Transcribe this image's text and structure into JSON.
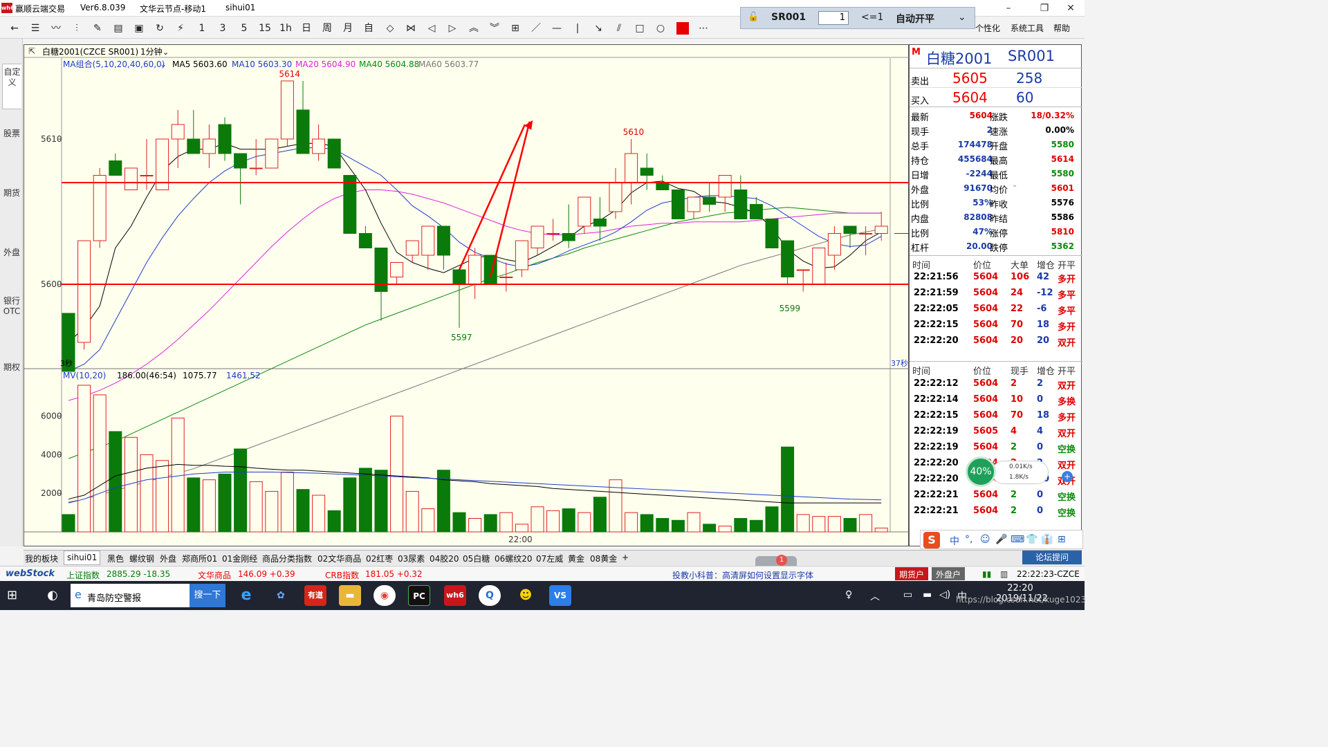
{
  "window": {
    "app_name": "赢顺云端交易",
    "version": "Ver6.8.039",
    "server": "文华云节点-移动1",
    "user": "sihui01",
    "logo_text": "wh6"
  },
  "trade_widget": {
    "contract": "SR001",
    "quantity": "1",
    "limit": "<=1",
    "mode": "自动开平"
  },
  "toolbar": {
    "buttons": [
      "back-icon",
      "table-icon",
      "line-chart-icon",
      "bar-icon",
      "pen-icon",
      "report-icon",
      "save-icon",
      "refresh-icon",
      "zigzag-icon"
    ],
    "periods": [
      "1",
      "3",
      "5",
      "15",
      "1h",
      "日",
      "周",
      "月",
      "自"
    ],
    "draw_tools": [
      "fit-icon",
      "collapse-icon",
      "left-icon",
      "right-icon",
      "up-icon",
      "down-icon",
      "grid-icon",
      "line-icon",
      "hline-icon",
      "vline-icon",
      "ray-icon",
      "parallel-icon",
      "rect-icon",
      "ellipse-icon",
      "color-icon",
      "more-icon"
    ],
    "menus": [
      "个性化",
      "系统工具",
      "帮助"
    ]
  },
  "left_tabs": [
    "自定义",
    "股票",
    "期货",
    "外盘",
    "银行OTC",
    "期权"
  ],
  "chart": {
    "header_title": "白糖2001(CZCE SR001)",
    "period": "1分钟",
    "ma_group": "MA组合(5,10,20,40,60,0)",
    "ma_labels": [
      {
        "text": "MA5 5603.60",
        "color": "#000000"
      },
      {
        "text": "MA10 5603.30",
        "color": "#1e3ccc"
      },
      {
        "text": "MA20 5604.90",
        "color": "#dd22dd"
      },
      {
        "text": "MA40 5604.88",
        "color": "#0a8a0a"
      },
      {
        "text": "MA60 5603.77",
        "color": "#777777"
      }
    ],
    "y_ticks": [
      "5610",
      "5600"
    ],
    "annotations": [
      "5614",
      "5610",
      "5597",
      "5599"
    ],
    "bottom_left_label": "3秒",
    "bottom_right_label": "37秒",
    "time_label": "22:00",
    "volume_header": "MV(10,20)",
    "volume_values": [
      "186.00(46:54)",
      "1075.77",
      "1461.52"
    ],
    "volume_y_ticks": [
      "6000",
      "4000",
      "2000"
    ],
    "support_price": 5600,
    "resistance_price": 5607,
    "colors": {
      "up": "#e02020",
      "down": "#0a7a0a",
      "bg": "#ffffee",
      "hline": "#ff0000"
    },
    "candles": [
      [
        5598.0,
        5597.5,
        5594.0,
        5594.0
      ],
      [
        5596.0,
        5603.0,
        5595.5,
        5603.0
      ],
      [
        5603.0,
        5608.0,
        5602.5,
        5607.5
      ],
      [
        5608.5,
        5609.0,
        5607.5,
        5607.5
      ],
      [
        5606.5,
        5608.0,
        5606.5,
        5608.0
      ],
      [
        5607.5,
        5610.0,
        5606.5,
        5607.5
      ],
      [
        5606.5,
        5610.0,
        5606.5,
        5610.0
      ],
      [
        5610.0,
        5612.0,
        5608.0,
        5611.0
      ],
      [
        5610.0,
        5612.0,
        5609.0,
        5609.0
      ],
      [
        5609.0,
        5611.0,
        5608.0,
        5610.0
      ],
      [
        5611.0,
        5611.5,
        5608.5,
        5609.0
      ],
      [
        5609.0,
        5609.0,
        5605.5,
        5608.0
      ],
      [
        5608.0,
        5610.0,
        5607.5,
        5608.0
      ],
      [
        5608.0,
        5610.0,
        5608.0,
        5610.0
      ],
      [
        5610.0,
        5614.0,
        5609.5,
        5614.0
      ],
      [
        5612.0,
        5614.0,
        5609.0,
        5609.0
      ],
      [
        5609.0,
        5611.0,
        5608.5,
        5610.0
      ],
      [
        5610.0,
        5610.0,
        5608.0,
        5608.0
      ],
      [
        5607.5,
        5607.5,
        5603.5,
        5603.5
      ],
      [
        5603.5,
        5604.0,
        5602.5,
        5602.5
      ],
      [
        5602.5,
        5602.5,
        5597.5,
        5599.5
      ],
      [
        5600.5,
        5601.5,
        5600.0,
        5601.5
      ],
      [
        5602.0,
        5603.0,
        5601.5,
        5603.0
      ],
      [
        5602.0,
        5604.0,
        5601.0,
        5604.0
      ],
      [
        5604.0,
        5604.0,
        5601.0,
        5602.0
      ],
      [
        5601.0,
        5601.0,
        5597.0,
        5600.0
      ],
      [
        5600.0,
        5602.5,
        5599.0,
        5602.0
      ],
      [
        5602.0,
        5602.0,
        5600.0,
        5600.0
      ],
      [
        5600.5,
        5601.5,
        5599.5,
        5600.5
      ],
      [
        5601.0,
        5603.0,
        5600.5,
        5603.0
      ],
      [
        5602.5,
        5604.0,
        5602.0,
        5604.0
      ],
      [
        5603.5,
        5604.5,
        5603.0,
        5603.5
      ],
      [
        5603.5,
        5605.5,
        5602.5,
        5603.0
      ],
      [
        5604.0,
        5606.0,
        5603.5,
        5606.0
      ],
      [
        5604.5,
        5606.0,
        5603.0,
        5604.0
      ],
      [
        5605.0,
        5608.0,
        5604.5,
        5607.0
      ],
      [
        5607.0,
        5610.0,
        5605.5,
        5609.0
      ],
      [
        5608.0,
        5609.0,
        5606.5,
        5607.5
      ],
      [
        5607.0,
        5607.5,
        5606.5,
        5606.5
      ],
      [
        5606.5,
        5606.5,
        5604.5,
        5604.5
      ],
      [
        5605.0,
        5606.0,
        5604.5,
        5606.0
      ],
      [
        5606.0,
        5607.0,
        5605.0,
        5605.5
      ],
      [
        5606.0,
        5607.5,
        5605.0,
        5607.5
      ],
      [
        5606.5,
        5607.5,
        5604.5,
        5604.5
      ],
      [
        5605.5,
        5606.0,
        5604.5,
        5604.5
      ],
      [
        5604.5,
        5604.5,
        5602.5,
        5602.5
      ],
      [
        5603.0,
        5603.0,
        5600.0,
        5600.5
      ],
      [
        5601.0,
        5601.0,
        5599.5,
        5601.0
      ],
      [
        5600.0,
        5602.5,
        5600.0,
        5602.5
      ],
      [
        5602.0,
        5604.0,
        5601.0,
        5603.5
      ],
      [
        5604.0,
        5604.0,
        5602.5,
        5603.5
      ],
      [
        5603.5,
        5604.0,
        5602.0,
        5603.5
      ],
      [
        5603.5,
        5605.0,
        5603.0,
        5604.0
      ]
    ],
    "volumes": [
      900,
      7600,
      7100,
      5200,
      4900,
      4000,
      3700,
      5900,
      2800,
      2700,
      3000,
      4300,
      2600,
      2100,
      3100,
      2200,
      1900,
      1100,
      2800,
      3300,
      3200,
      6000,
      2100,
      1200,
      3200,
      1000,
      700,
      900,
      1000,
      400,
      1300,
      1100,
      1200,
      1000,
      1800,
      2700,
      1000,
      900,
      700,
      600,
      1000,
      400,
      300,
      700,
      600,
      1300,
      4400,
      900,
      800,
      800,
      700,
      900,
      200
    ],
    "ma5": [
      5596.0,
      5597.0,
      5598.5,
      5602.5,
      5604.0,
      5606.0,
      5607.8,
      5608.8,
      5609.3,
      5609.3,
      5609.7,
      5609.3,
      5609.3,
      5609.3,
      5609.5,
      5609.7,
      5609.7,
      5609.5,
      5608.0,
      5606.5,
      5604.2,
      5602.2,
      5601.5,
      5601.1,
      5600.8,
      5601.3,
      5601.8,
      5602.0,
      5601.7,
      5601.5,
      5602.0,
      5602.6,
      5603.2,
      5604.0,
      5604.4,
      5605.1,
      5606.3,
      5607.0,
      5607.1,
      5606.6,
      5606.4,
      5605.7,
      5605.6,
      5605.3,
      5604.9,
      5603.9,
      5602.4,
      5601.6,
      5601.1,
      5601.2,
      5602.0,
      5603.0,
      5603.6
    ],
    "ma10": [
      5594.0,
      5594.5,
      5595.5,
      5597.5,
      5599.5,
      5601.5,
      5603.2,
      5604.7,
      5605.9,
      5607.0,
      5607.8,
      5608.4,
      5608.8,
      5609.0,
      5609.2,
      5609.4,
      5609.4,
      5609.3,
      5608.7,
      5608.1,
      5607.5,
      5606.5,
      5605.4,
      5604.7,
      5603.9,
      5602.9,
      5602.2,
      5601.8,
      5601.4,
      5601.2,
      5601.4,
      5601.8,
      5602.3,
      5602.7,
      5603.1,
      5603.6,
      5604.3,
      5605.1,
      5605.6,
      5605.8,
      5606.0,
      5606.1,
      5606.1,
      5606.0,
      5605.9,
      5605.4,
      5604.7,
      5604.0,
      5603.3,
      5602.8,
      5602.6,
      5602.7,
      5603.3
    ],
    "ma20": [
      5592.0,
      5592.3,
      5592.7,
      5593.2,
      5593.8,
      5594.5,
      5595.3,
      5596.2,
      5597.2,
      5598.2,
      5599.3,
      5600.4,
      5601.5,
      5602.6,
      5603.6,
      5604.5,
      5605.3,
      5605.9,
      5606.3,
      5606.5,
      5606.5,
      5606.4,
      5606.2,
      5605.9,
      5605.6,
      5605.2,
      5604.8,
      5604.4,
      5604.0,
      5603.7,
      5603.5,
      5603.4,
      5603.4,
      5603.5,
      5603.6,
      5603.8,
      5604.0,
      5604.1,
      5604.2,
      5604.2,
      5604.3,
      5604.3,
      5604.3,
      5604.3,
      5604.4,
      5604.5,
      5604.6,
      5604.7,
      5604.8,
      5604.9,
      5604.9,
      5604.9,
      5604.9
    ],
    "ma40": [
      5588.0,
      5588.4,
      5588.8,
      5589.2,
      5589.7,
      5590.2,
      5590.7,
      5591.2,
      5591.7,
      5592.2,
      5592.7,
      5593.2,
      5593.7,
      5594.2,
      5594.7,
      5595.2,
      5595.7,
      5596.2,
      5596.7,
      5597.2,
      5597.6,
      5598.0,
      5598.4,
      5598.8,
      5599.2,
      5599.6,
      5600.0,
      5600.4,
      5600.7,
      5601.1,
      5601.5,
      5601.8,
      5602.1,
      5602.5,
      5602.8,
      5603.1,
      5603.4,
      5603.7,
      5604.0,
      5604.3,
      5604.5,
      5604.7,
      5604.9,
      5605.0,
      5605.1,
      5605.2,
      5605.3,
      5605.2,
      5605.1,
      5605.0,
      5604.9,
      5604.9,
      5604.9
    ],
    "ma60": [
      5585.0,
      5585.2,
      5585.5,
      5585.8,
      5586.1,
      5586.4,
      5586.7,
      5587.0,
      5587.3,
      5587.7,
      5588.1,
      5588.5,
      5588.9,
      5589.3,
      5589.7,
      5590.1,
      5590.5,
      5590.9,
      5591.3,
      5591.7,
      5592.1,
      5592.5,
      5592.9,
      5593.3,
      5593.7,
      5594.1,
      5594.5,
      5594.9,
      5595.3,
      5595.7,
      5596.1,
      5596.5,
      5596.9,
      5597.3,
      5597.7,
      5598.1,
      5598.5,
      5598.9,
      5599.3,
      5599.7,
      5600.1,
      5600.5,
      5600.9,
      5601.3,
      5601.6,
      5601.9,
      5602.2,
      5602.5,
      5602.8,
      5603.1,
      5603.4,
      5603.6,
      5603.8
    ],
    "vol_ma10": [
      1700,
      1900,
      2400,
      2900,
      3100,
      3300,
      3400,
      3500,
      3450,
      3450,
      3400,
      3380,
      3300,
      3250,
      3200,
      3200,
      3150,
      3100,
      3050,
      3000,
      2950,
      2900,
      2850,
      2800,
      2700,
      2650,
      2600,
      2500,
      2450,
      2400,
      2350,
      2250,
      2200,
      2150,
      2100,
      2050,
      2000,
      1950,
      1900,
      1850,
      1800,
      1750,
      1700,
      1650,
      1600,
      1550,
      1500,
      1500,
      1500,
      1500,
      1500,
      1500,
      1500
    ],
    "vol_ma20": [
      1500,
      1700,
      2000,
      2300,
      2500,
      2700,
      2800,
      2900,
      3000,
      3050,
      3100,
      3100,
      3100,
      3100,
      3080,
      3060,
      3040,
      3000,
      2970,
      2940,
      2900,
      2860,
      2820,
      2780,
      2740,
      2700,
      2660,
      2620,
      2580,
      2540,
      2500,
      2460,
      2420,
      2380,
      2340,
      2300,
      2260,
      2220,
      2180,
      2140,
      2100,
      2060,
      2020,
      1980,
      1940,
      1900,
      1860,
      1820,
      1780,
      1740,
      1700,
      1680,
      1660
    ]
  },
  "quote": {
    "marker": "M",
    "name": "白糖2001",
    "code": "SR001",
    "ask_label": "卖出",
    "ask_price": "5605",
    "ask_vol": "258",
    "bid_label": "买入",
    "bid_price": "5604",
    "bid_vol": "60",
    "left_stats": [
      {
        "k": "最新",
        "v": "5604",
        "c": "#e00000"
      },
      {
        "k": "现手",
        "v": "2",
        "c": "#1a3aa8"
      },
      {
        "k": "总手",
        "v": "174478",
        "c": "#1a3aa8"
      },
      {
        "k": "持仓",
        "v": "455684",
        "c": "#1a3aa8"
      },
      {
        "k": "日增",
        "v": "-2244",
        "c": "#1a3aa8"
      },
      {
        "k": "外盘",
        "v": "91670",
        "c": "#1a3aa8"
      },
      {
        "k": "比例",
        "v": "53%",
        "c": "#1a3aa8"
      },
      {
        "k": "内盘",
        "v": "82808",
        "c": "#1a3aa8"
      },
      {
        "k": "比例",
        "v": "47%",
        "c": "#1a3aa8"
      },
      {
        "k": "杠杆",
        "v": "20.00",
        "c": "#1a3aa8"
      }
    ],
    "right_stats": [
      {
        "k": "涨跌",
        "v": "18/0.32%",
        "c": "#e00000"
      },
      {
        "k": "速涨",
        "v": "0.00%",
        "c": "#000000"
      },
      {
        "k": "开盘",
        "v": "5580",
        "c": "#0a8a0a"
      },
      {
        "k": "最高",
        "v": "5614",
        "c": "#e00000"
      },
      {
        "k": "最低",
        "v": "5580",
        "c": "#0a8a0a"
      },
      {
        "k": "均价",
        "v": "5601",
        "c": "#e00000"
      },
      {
        "k": "昨收",
        "v": "5576",
        "c": "#000000"
      },
      {
        "k": "昨结",
        "v": "5586",
        "c": "#000000"
      },
      {
        "k": "涨停",
        "v": "5810",
        "c": "#e00000"
      },
      {
        "k": "跌停",
        "v": "5362",
        "c": "#0a8a0a"
      }
    ],
    "big_header": [
      "时间",
      "价位",
      "大单",
      "增仓",
      "开平"
    ],
    "big_rows": [
      [
        "22:21:56",
        "5604",
        "106",
        "42",
        "多开"
      ],
      [
        "22:21:59",
        "5604",
        "24",
        "-12",
        "多平"
      ],
      [
        "22:22:05",
        "5604",
        "22",
        "-6",
        "多平"
      ],
      [
        "22:22:15",
        "5604",
        "70",
        "18",
        "多开"
      ],
      [
        "22:22:20",
        "5604",
        "20",
        "20",
        "双开"
      ]
    ],
    "tick_header": [
      "时间",
      "价位",
      "现手",
      "增仓",
      "开平"
    ],
    "tick_rows": [
      [
        "22:22:12",
        "5604",
        "2",
        "2",
        "双开",
        "#e00000"
      ],
      [
        "22:22:14",
        "5604",
        "10",
        "0",
        "多换",
        "#e00000"
      ],
      [
        "22:22:15",
        "5604",
        "70",
        "18",
        "多开",
        "#e00000"
      ],
      [
        "22:22:19",
        "5605",
        "4",
        "4",
        "双开",
        "#e00000"
      ],
      [
        "22:22:19",
        "5604",
        "2",
        "0",
        "空换",
        "#0a8a0a"
      ],
      [
        "22:22:20",
        "5604",
        "2",
        "2",
        "双开",
        "#e00000"
      ],
      [
        "22:22:20",
        "5604",
        "20",
        "20",
        "双开",
        "#e00000"
      ],
      [
        "22:22:21",
        "5604",
        "2",
        "0",
        "空换",
        "#0a8a0a"
      ],
      [
        "22:22:21",
        "5604",
        "2",
        "0",
        "空换",
        "#0a8a0a"
      ]
    ]
  },
  "speed_widget": {
    "percent": "40%",
    "up": "0.01K/s",
    "down": "1.8K/s"
  },
  "ime_bar": [
    "S",
    "中",
    "°,",
    "☺",
    "🎤",
    "⌨",
    "👕",
    "👔",
    "⊞"
  ],
  "bottom_tabs": [
    "我的板块",
    "sihui01",
    "黑色",
    "螺纹钢",
    "外盘",
    "郑商所01",
    "01金刚经",
    "商品分类指数",
    "02文华商品",
    "02红枣",
    "03尿素",
    "04胶20",
    "05白糖",
    "06螺纹20",
    "07左威",
    "黄金",
    "08黄金",
    "+"
  ],
  "forum_button": "论坛提问",
  "status": {
    "brand": "webStock",
    "index1_name": "上证指数",
    "index1_val": "2885.29 -18.35",
    "index2_name": "文华商品",
    "index2_val": "146.09 +0.39",
    "index3_name": "CRB指数",
    "index3_val": "181.05 +0.32",
    "tip": "投教小科普：高清屏如何设置显示字体",
    "futures_acct": "期货户",
    "foreign_acct": "外盘户",
    "clock": "22:22:23-CZCE",
    "mail_badge": "1"
  },
  "taskbar": {
    "search_text": "青岛防空警报",
    "search_btn": "搜一下",
    "time": "22:20",
    "date": "2019/11/22",
    "watermark": "https://blog.csdn.net/kuge1023",
    "ime_zh": "中"
  }
}
